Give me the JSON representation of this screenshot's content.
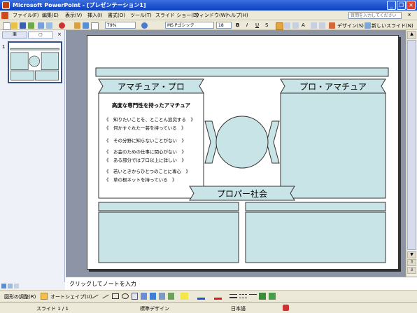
{
  "window": {
    "title": "Microsoft PowerPoint - [プレゼンテーション1]",
    "minimize_symbol": "_",
    "restore_symbol": "❐",
    "close_symbol": "✕"
  },
  "menu": {
    "items": [
      "ファイル(F)",
      "編集(E)",
      "表示(V)",
      "挿入(I)",
      "書式(O)",
      "ツール(T)",
      "スライド ショー(D)",
      "ウィンドウ(W)",
      "ヘルプ(H)"
    ],
    "help_placeholder": "質問を入力してください",
    "close_symbol": "x"
  },
  "toolbar": {
    "zoom": "79%",
    "font_name": "MS Pゴシック",
    "font_size": "18",
    "bold": "B",
    "italic": "I",
    "underline": "U",
    "shadow": "S",
    "grow_font": "A",
    "design_label": "デザイン(S)",
    "new_slide_label": "新しいスライド(N)"
  },
  "outline": {
    "tab_outline": "亜",
    "tab_slides": "▢",
    "slide_number": "1"
  },
  "slide": {
    "amateur_pro": "アマチュア・プロ",
    "pro_amateur": "プロ・アマチュア",
    "proper_society": "プロパー社会",
    "subtitle": "高度な専門性を持ったアマチュア",
    "bullets": [
      "《　知りたいことを、とことん追究する　》",
      "《　何かすぐれた一芸を持っている　》",
      "《　その分野に知らないことがない　》",
      "《　お金のための仕事に関心がない　》",
      "《　ある部分ではプロ以上に詳しい　》",
      "《　若いときからひとつのことに専心　》",
      "《　草の根ネットを持っている　》"
    ]
  },
  "notes": {
    "placeholder": "クリックしてノートを入力"
  },
  "drawing": {
    "draw_menu": "図形の調整(R)",
    "autoshapes": "オートシェイプ(U)"
  },
  "status": {
    "slide": "スライド 1 / 1",
    "design": "標準デザイン",
    "language": "日本語"
  },
  "colors": {
    "shape_fill": "#c9e4e6",
    "outline": "#333333",
    "titlebar": "#0a3fc0",
    "chrome": "#ece9d8",
    "workspace": "#8c94a6"
  }
}
